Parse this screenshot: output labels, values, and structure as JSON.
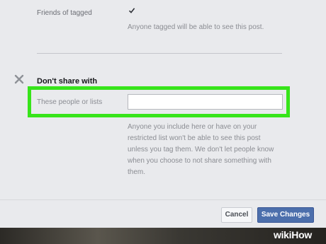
{
  "privacy": {
    "friends_of_tagged": {
      "label": "Friends of tagged",
      "checked": true,
      "help": "Anyone tagged will be able to see this post."
    },
    "dont_share": {
      "title": "Don't share with",
      "field_label": "These people or lists",
      "field_value": "",
      "help_lines": [
        "Anyone you include here or have on your",
        "restricted list won't be able to see this post",
        "unless you tag them. We don't let people know",
        "when you choose to not share something with",
        "them."
      ]
    }
  },
  "footer": {
    "cancel_label": "Cancel",
    "save_label": "Save Changes"
  },
  "watermark": {
    "wiki": "wiki",
    "how": "How"
  },
  "colors": {
    "highlight": "#37e41a",
    "primary_button": "#4c6fac"
  }
}
